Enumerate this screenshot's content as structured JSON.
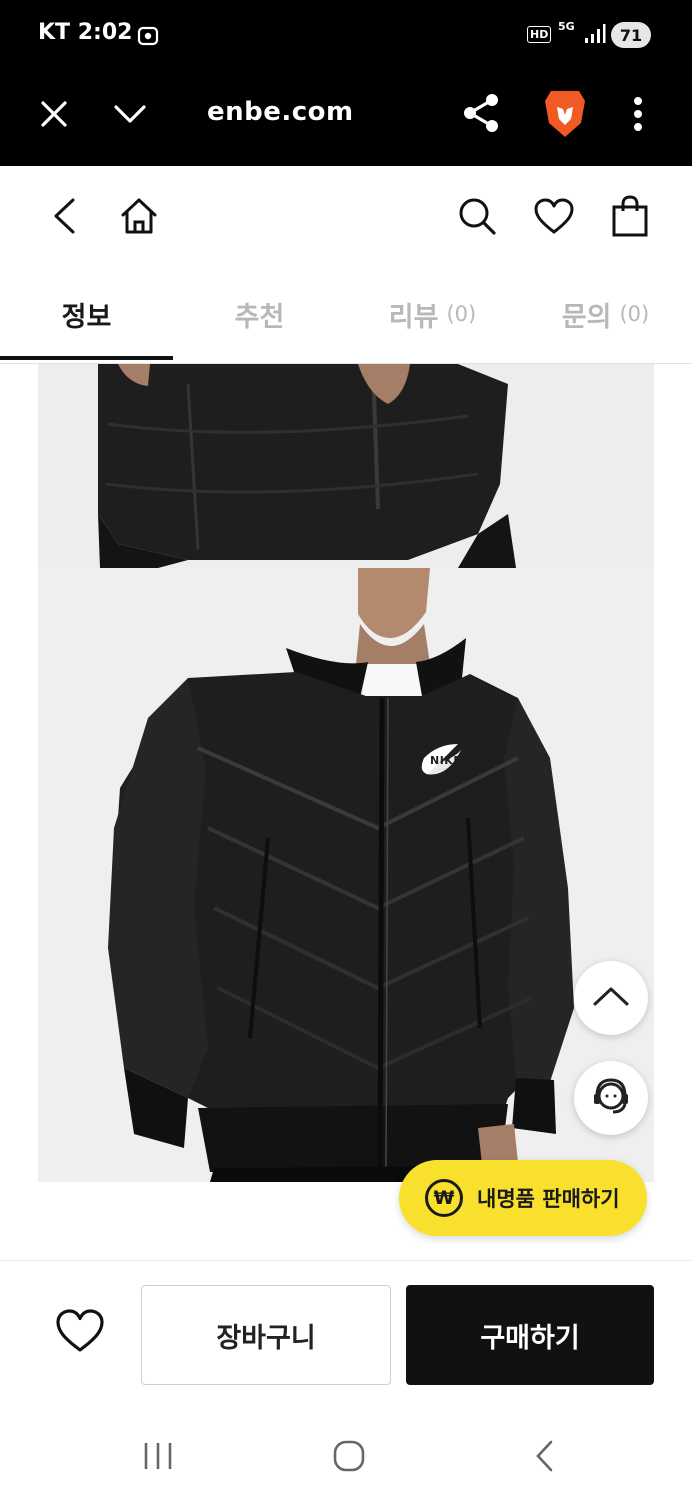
{
  "status_bar": {
    "carrier_time": "KT 2:02",
    "hd_badge": "HD",
    "network": "5G",
    "battery": "71"
  },
  "browser": {
    "url": "enbe.com",
    "icons": [
      "close-icon",
      "chevron-down-icon",
      "share-icon",
      "brave-lion-icon",
      "more-vert-icon"
    ]
  },
  "header": {
    "icons": [
      "back-arrow-icon",
      "home-icon",
      "search-icon",
      "heart-icon",
      "shopping-bag-icon"
    ]
  },
  "tabs": [
    {
      "label": "정보",
      "count": "",
      "active": true
    },
    {
      "label": "추천",
      "count": "",
      "active": false
    },
    {
      "label": "리뷰",
      "count": "(0)",
      "active": false
    },
    {
      "label": "문의",
      "count": "(0)",
      "active": false
    }
  ],
  "product": {
    "logo_text": "NIKE"
  },
  "floating": {
    "sell_label": "내명품 판매하기",
    "sell_icon_text": "₩"
  },
  "bottom": {
    "cart_label": "장바구니",
    "buy_label": "구매하기"
  },
  "colors": {
    "accent_yellow": "#f8e02d",
    "buy_black": "#111111",
    "jacket": "#1e1e1f",
    "photo_bg": "#efefef"
  }
}
